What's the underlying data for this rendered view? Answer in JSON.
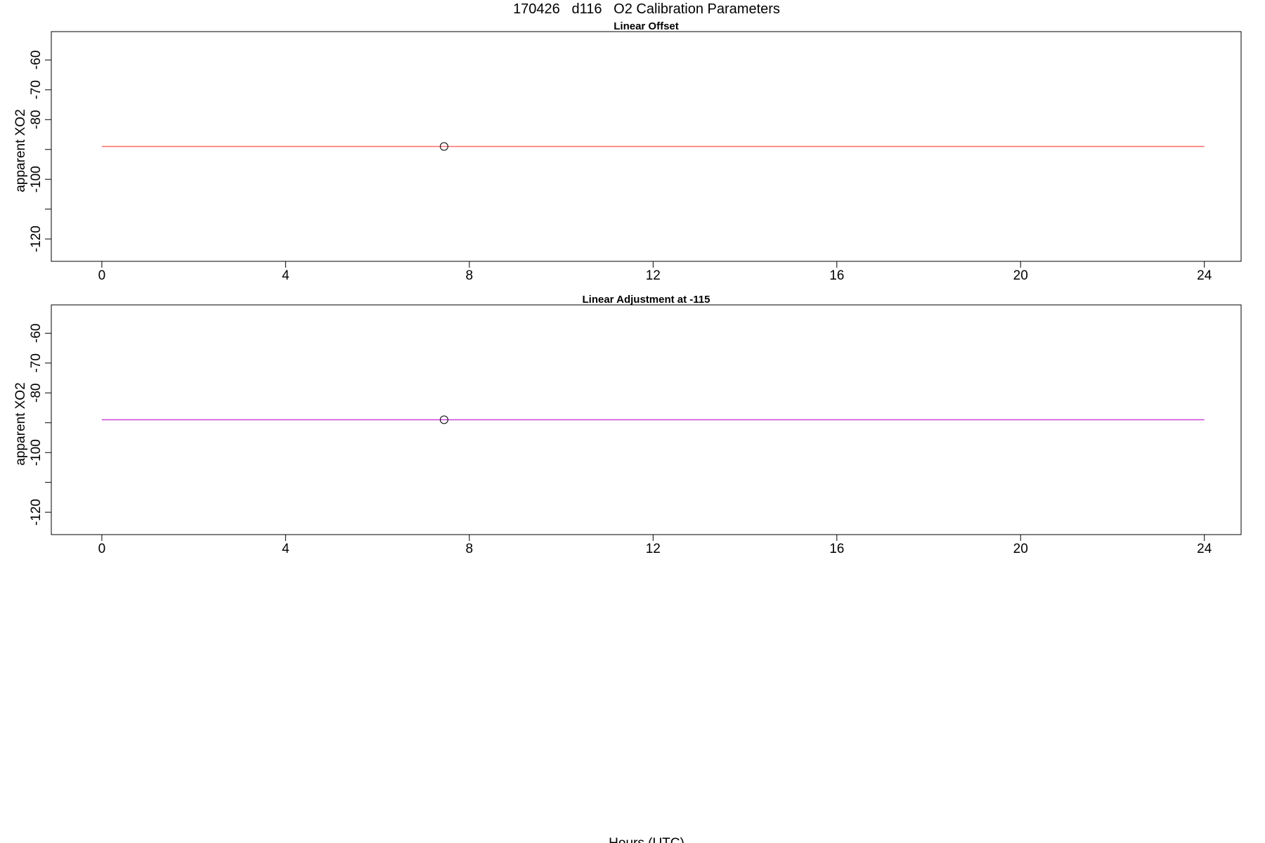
{
  "figure": {
    "main_title": "170426   d116   O2 Calibration Parameters",
    "xlabel": "Hours (UTC)"
  },
  "chart_data": [
    {
      "type": "line",
      "title": "Linear Offset",
      "xlabel": "",
      "ylabel": "apparent XO2",
      "xlim": [
        -1.1,
        24.8
      ],
      "ylim": [
        -127.5,
        -50.5
      ],
      "xticks": [
        0,
        4,
        8,
        12,
        16,
        20,
        24
      ],
      "yticks": [
        -120,
        -110,
        -100,
        -90,
        -80,
        -70,
        -60
      ],
      "ytick_labels": [
        "-120",
        "",
        "-100",
        "",
        "-80",
        "-70",
        "-60"
      ],
      "grid": false,
      "series": [
        {
          "kind": "line",
          "color": "#ff6b6b",
          "x": [
            0,
            24
          ],
          "y": [
            -89,
            -89
          ]
        },
        {
          "kind": "point",
          "marker": "open-circle",
          "color": "#000000",
          "x": [
            7.45
          ],
          "y": [
            -89
          ]
        }
      ]
    },
    {
      "type": "line",
      "title": "Linear Adjustment at -115",
      "xlabel": "",
      "ylabel": "apparent XO2",
      "xlim": [
        -1.1,
        24.8
      ],
      "ylim": [
        -127.5,
        -50.5
      ],
      "xticks": [
        0,
        4,
        8,
        12,
        16,
        20,
        24
      ],
      "yticks": [
        -120,
        -110,
        -100,
        -90,
        -80,
        -70,
        -60
      ],
      "ytick_labels": [
        "-120",
        "",
        "-100",
        "",
        "-80",
        "-70",
        "-60"
      ],
      "grid": false,
      "series": [
        {
          "kind": "line",
          "color": "#cc44dd",
          "x": [
            0,
            24
          ],
          "y": [
            -89,
            -89
          ]
        },
        {
          "kind": "point",
          "marker": "open-circle",
          "color": "#000000",
          "x": [
            7.45
          ],
          "y": [
            -89
          ]
        }
      ]
    }
  ]
}
